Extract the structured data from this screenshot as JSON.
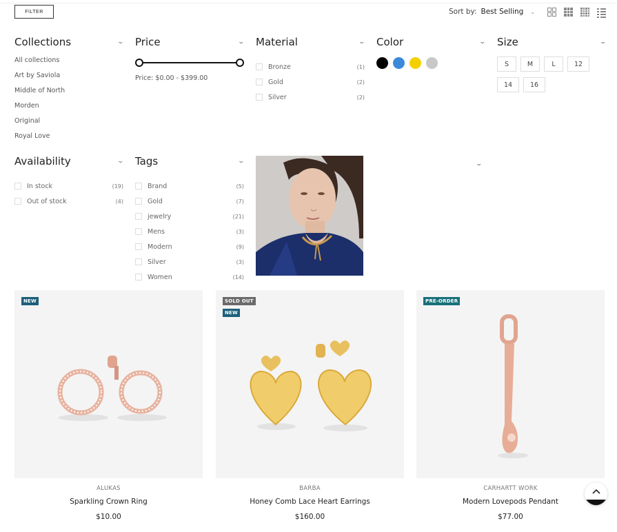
{
  "toolbar": {
    "filter_label": "FILTER",
    "sort_label": "Sort by:",
    "sort_value": "Best Selling",
    "view_icons": [
      "grid-2-icon",
      "grid-3-icon",
      "grid-4-icon",
      "list-view-icon"
    ]
  },
  "filters": {
    "collections": {
      "title": "Collections",
      "items": [
        "All collections",
        "Art by Saviola",
        "Middle of North",
        "Morden",
        "Original",
        "Royal Love"
      ]
    },
    "price": {
      "title": "Price",
      "range_text": "Price: $0.00 - $399.00",
      "min_fraction": 0,
      "max_fraction": 1
    },
    "material": {
      "title": "Material",
      "items": [
        {
          "label": "Bronze",
          "count": "(1)"
        },
        {
          "label": "Gold",
          "count": "(2)"
        },
        {
          "label": "Silver",
          "count": "(2)"
        }
      ]
    },
    "color": {
      "title": "Color",
      "swatches": [
        "#000000",
        "#3b8ad9",
        "#f5d000",
        "#c8c8c8"
      ]
    },
    "size": {
      "title": "Size",
      "options": [
        "S",
        "M",
        "L",
        "12",
        "14",
        "16"
      ]
    },
    "availability": {
      "title": "Availability",
      "items": [
        {
          "label": "In stock",
          "count": "(19)"
        },
        {
          "label": "Out of stock",
          "count": "(4)"
        }
      ]
    },
    "tags": {
      "title": "Tags",
      "items": [
        {
          "label": "Brand",
          "count": "(5)"
        },
        {
          "label": "Gold",
          "count": "(7)"
        },
        {
          "label": "jewelry",
          "count": "(21)"
        },
        {
          "label": "Mens",
          "count": "(3)"
        },
        {
          "label": "Modern",
          "count": "(9)"
        },
        {
          "label": "Silver",
          "count": "(3)"
        },
        {
          "label": "Women",
          "count": "(14)"
        }
      ]
    }
  },
  "products": [
    {
      "badges": [
        "NEW"
      ],
      "vendor": "ALUKAS",
      "name": "Sparkling Crown Ring",
      "price": "$10.00"
    },
    {
      "badges": [
        "SOLD OUT",
        "NEW"
      ],
      "vendor": "BARBA",
      "name": "Honey Comb Lace Heart Earrings",
      "price": "$160.00"
    },
    {
      "badges": [
        "PRE-ORDER"
      ],
      "vendor": "CARHARTT WORK",
      "name": "Modern Lovepods Pendant",
      "price": "$77.00"
    }
  ],
  "colors": {
    "badge_new": "#1b5f7a",
    "badge_sold_out": "#6a6a6a",
    "badge_pre_order": "#18707a"
  }
}
